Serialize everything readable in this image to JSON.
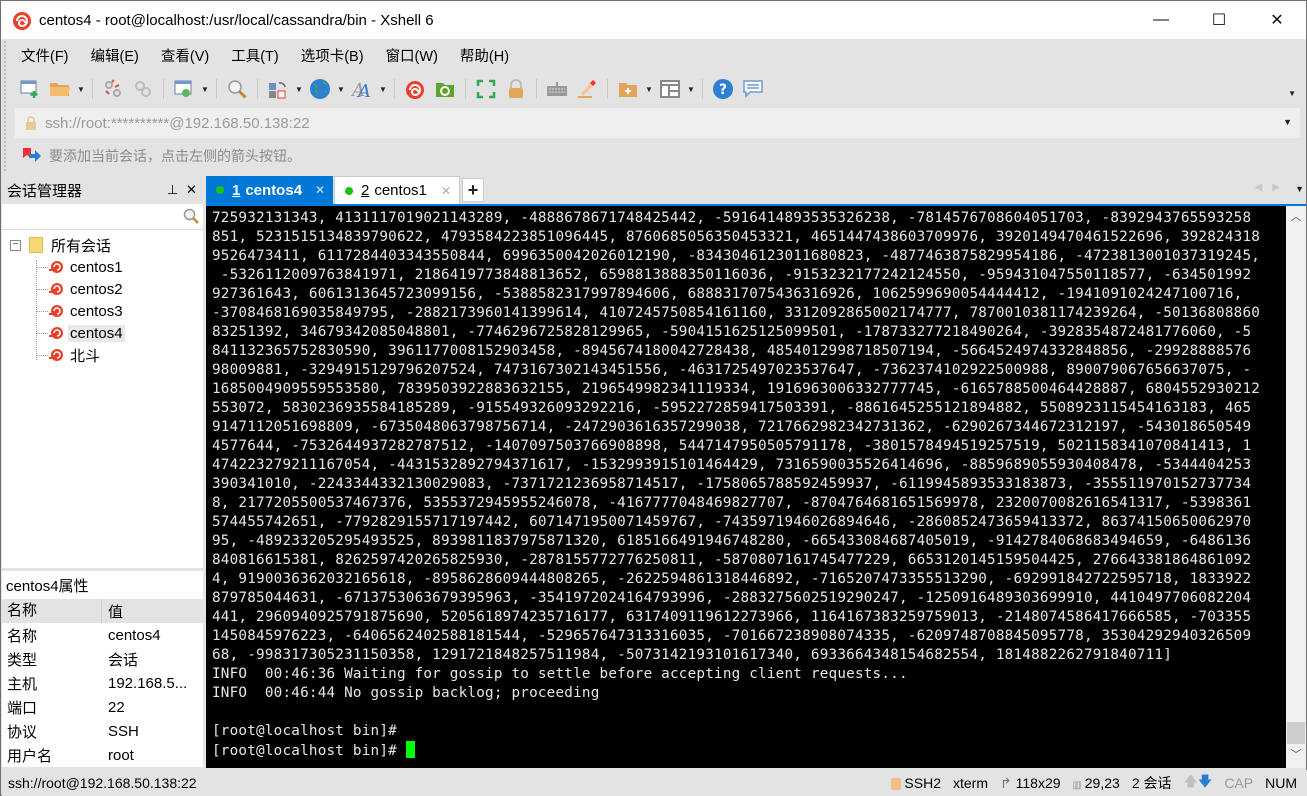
{
  "window": {
    "title": "centos4 - root@localhost:/usr/local/cassandra/bin - Xshell 6",
    "controls": {
      "minimize": "—",
      "maximize": "☐",
      "close": "✕"
    }
  },
  "menu": [
    "文件(F)",
    "编辑(E)",
    "查看(V)",
    "工具(T)",
    "选项卡(B)",
    "窗口(W)",
    "帮助(H)"
  ],
  "toolbar": {
    "icons": [
      "new-session-icon",
      "open-folder-icon",
      "reconnect-icon",
      "disconnect-icon",
      "properties-icon",
      "find-icon",
      "transfer-icon",
      "globe-icon",
      "font-icon",
      "xshell-icon",
      "xftp-icon",
      "fullscreen-icon",
      "lock-icon",
      "keyboard-icon",
      "highlight-icon",
      "new-folder-icon",
      "layout-icon",
      "help-icon",
      "chat-icon"
    ]
  },
  "address_bar": {
    "value": "ssh://root:**********@192.168.50.138:22"
  },
  "hint_bar": {
    "text": "要添加当前会话，点击左侧的箭头按钮。"
  },
  "session_manager": {
    "title": "会话管理器",
    "pin": "⊥",
    "close": "✕",
    "search_placeholder": "",
    "root_label": "所有会话",
    "sessions": [
      {
        "label": "centos1",
        "selected": false
      },
      {
        "label": "centos2",
        "selected": false
      },
      {
        "label": "centos3",
        "selected": false
      },
      {
        "label": "centos4",
        "selected": true
      },
      {
        "label": "北斗",
        "selected": false
      }
    ]
  },
  "properties": {
    "title": "centos4属性",
    "header": {
      "name": "名称",
      "value": "值"
    },
    "rows": [
      {
        "name": "名称",
        "value": "centos4"
      },
      {
        "name": "类型",
        "value": "会话"
      },
      {
        "name": "主机",
        "value": "192.168.5..."
      },
      {
        "name": "端口",
        "value": "22"
      },
      {
        "name": "协议",
        "value": "SSH"
      },
      {
        "name": "用户名",
        "value": "root"
      }
    ]
  },
  "tabs": [
    {
      "num": "1",
      "label": "centos4",
      "active": true,
      "close": "✕"
    },
    {
      "num": "2",
      "label": "centos1",
      "active": false,
      "close": "✕"
    }
  ],
  "tab_add": "+",
  "terminal": {
    "lines": [
      "725932131343, 4131117019021143289, -4888678671748425442, -5916414893535326238, -7814576708604051703, -8392943765593258",
      "851, 5231515134839790622, 4793584223851096445, 8760685056350453321, 4651447438603709976, 3920149470461522696, 392824318",
      "9526473411, 6117284403343550844, 6996350042026012190, -8343046123011680823, -4877463875829954186, -4723813001037319245,",
      " -5326112009763841971, 2186419773848813652, 6598813888350116036, -9153232177242124550, -959431047550118577, -634501992",
      "927361643, 6061313645723099156, -5388582317997894606, 6888317075436316926, 1062599690054444412, -1941091024247100716,",
      "-3708468169035849795, -2882173960141399614, 4107245750854161160, 3312092865002174777, 7870010381174239264, -50136808860",
      "83251392, 3467934208504880 1, -7746296725828129965, -5904151625125099501, -1787332772184902 64, -3928354872481776060, -5",
      "841132365752830590, 3961177008152903458, -8945674180042728438, 4854012998718507194, -5664524974332848856, -29928888576",
      "98009881, -3294915129796207524, 7473167302143451556, -4631725497023537647, -7362374102922500988, 8900790676566370 75, -",
      "1685004909559553580, 7839503922883632155, 2196549982341119334, 1916963006332777745, -6165788500464428887, 6804552930212",
      "553072, 5830236935584185289, -9155493260932922 16, -5952272859417503391, -8861645255121894882, 5508923115454163183, 465",
      "9147112051698809, -6735048063798756714, -2472903616357299038, 7217662982342731362, -6290267344672312197, -543018650549",
      "4577644, -7532644937282787512, -1407097503766908898, 5447147950505791178, -3801578494519257519, 5021158341070841413, 1",
      "474223279211167054, -4431532892794371617, -1532993915101464429, 7316590035526414696, -8859689055930408478, -5344404253",
      "390341010, -2243344332130029083, -7371721236958714517, -1758065788592459937, -6119945893533183873, -35551197015273773 4",
      "8, 2177205500537467376, 5355372945955246078, -4167777048469827707, -8704764681651569978, 2320070082616541317, -5398361",
      "574455742651, -7792829155717197442, 6071471950071459767, -7435971946026894646, -2860852473659413372, 86374150650062970",
      "95, -489233205295493525, 8939811837975871320, 6185166491946748280, -6654330846874050 19, -9142784068683494659, -6486136",
      "840816615381, 8262597420265825930, -2878155772776250811, -5870807161745477229, 6653120145159504425, 276643381864861092",
      "4, 9190036362032165618, -8958628609444808265, -2622594861318446892, -7165207473355513290, -692991842722595718, 1833922",
      "879785044631, -6713753063679395963, -3541972024164793996, -2883275602519290247, -1250916489303699910, 4410497706082204",
      "441, 2960940925791875690, 5205618974235716177, 6317409119612273966, 1164167383259759013, -2148074586417666585, -703355",
      "1450845976223, -6406562402588181544, -5296576473133160 35, -7016672389080743 35, -6209748708845095778, 353042929403265 09",
      "68, -9983173052311503 58, 1291721848257511984, -5073142193101617340, 6933664348154682554, 1814882262791840711]",
      "INFO  00:46:36 Waiting for gossip to settle before accepting client requests...",
      "INFO  00:46:44 No gossip backlog; proceeding",
      "",
      "[root@localhost bin]#",
      "[root@localhost bin]# "
    ]
  },
  "status_bar": {
    "connection": "ssh://root@192.168.50.138:22",
    "protocol": "SSH2",
    "terminal_type": "xterm",
    "size": "118x29",
    "cursor_pos": "29,23",
    "sessions": "2 会话",
    "cap": "CAP",
    "num": "NUM"
  }
}
